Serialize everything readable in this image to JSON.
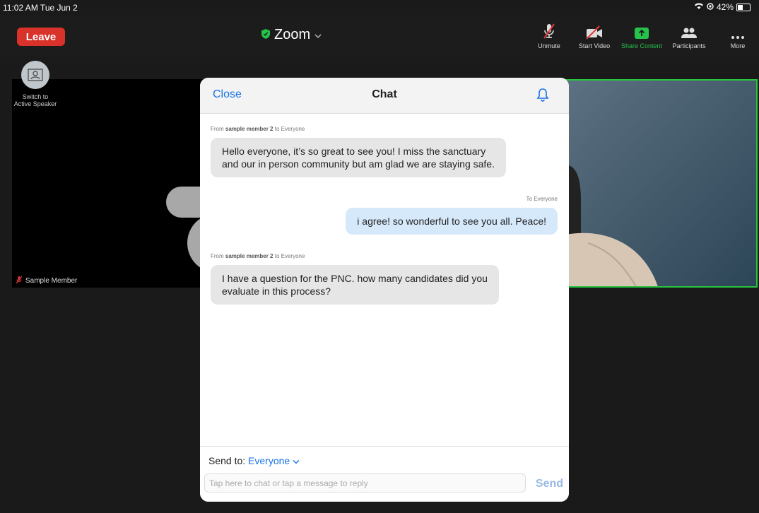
{
  "status": {
    "time": "11:02 AM  Tue Jun 2",
    "battery": "42%"
  },
  "toolbar": {
    "leave_label": "Leave",
    "title": "Zoom",
    "unmute_label": "Unmute",
    "start_video_label": "Start Video",
    "share_label": "Share Content",
    "participants_label": "Participants",
    "more_label": "More"
  },
  "video": {
    "switch_label": "Switch to",
    "switch_label2": "Active Speaker",
    "member_name": "Sample Member"
  },
  "chat": {
    "close_label": "Close",
    "title": "Chat",
    "messages": [
      {
        "from_prefix": "From",
        "from_name": "sample member 2",
        "to_text": "to Everyone",
        "line1": "Hello everyone, it’s so great to see you! I miss the sanctuary",
        "line2": "and our in person community but am glad we are staying safe."
      },
      {
        "to_text": "To Everyone",
        "text": "i agree! so wonderful to see you all. Peace!"
      },
      {
        "from_prefix": "From",
        "from_name": "sample member 2",
        "to_text": "to Everyone",
        "line1": "I have a question for the PNC. how many candidates did you",
        "line2": "evaluate in this process?"
      }
    ],
    "send_to_label": "Send to:",
    "send_to_value": "Everyone",
    "input_placeholder": "Tap here to chat or tap a message to reply",
    "send_label": "Send"
  },
  "colors": {
    "accent": "#1a73e8",
    "leave": "#d8322b",
    "active_border": "#28c43f"
  }
}
